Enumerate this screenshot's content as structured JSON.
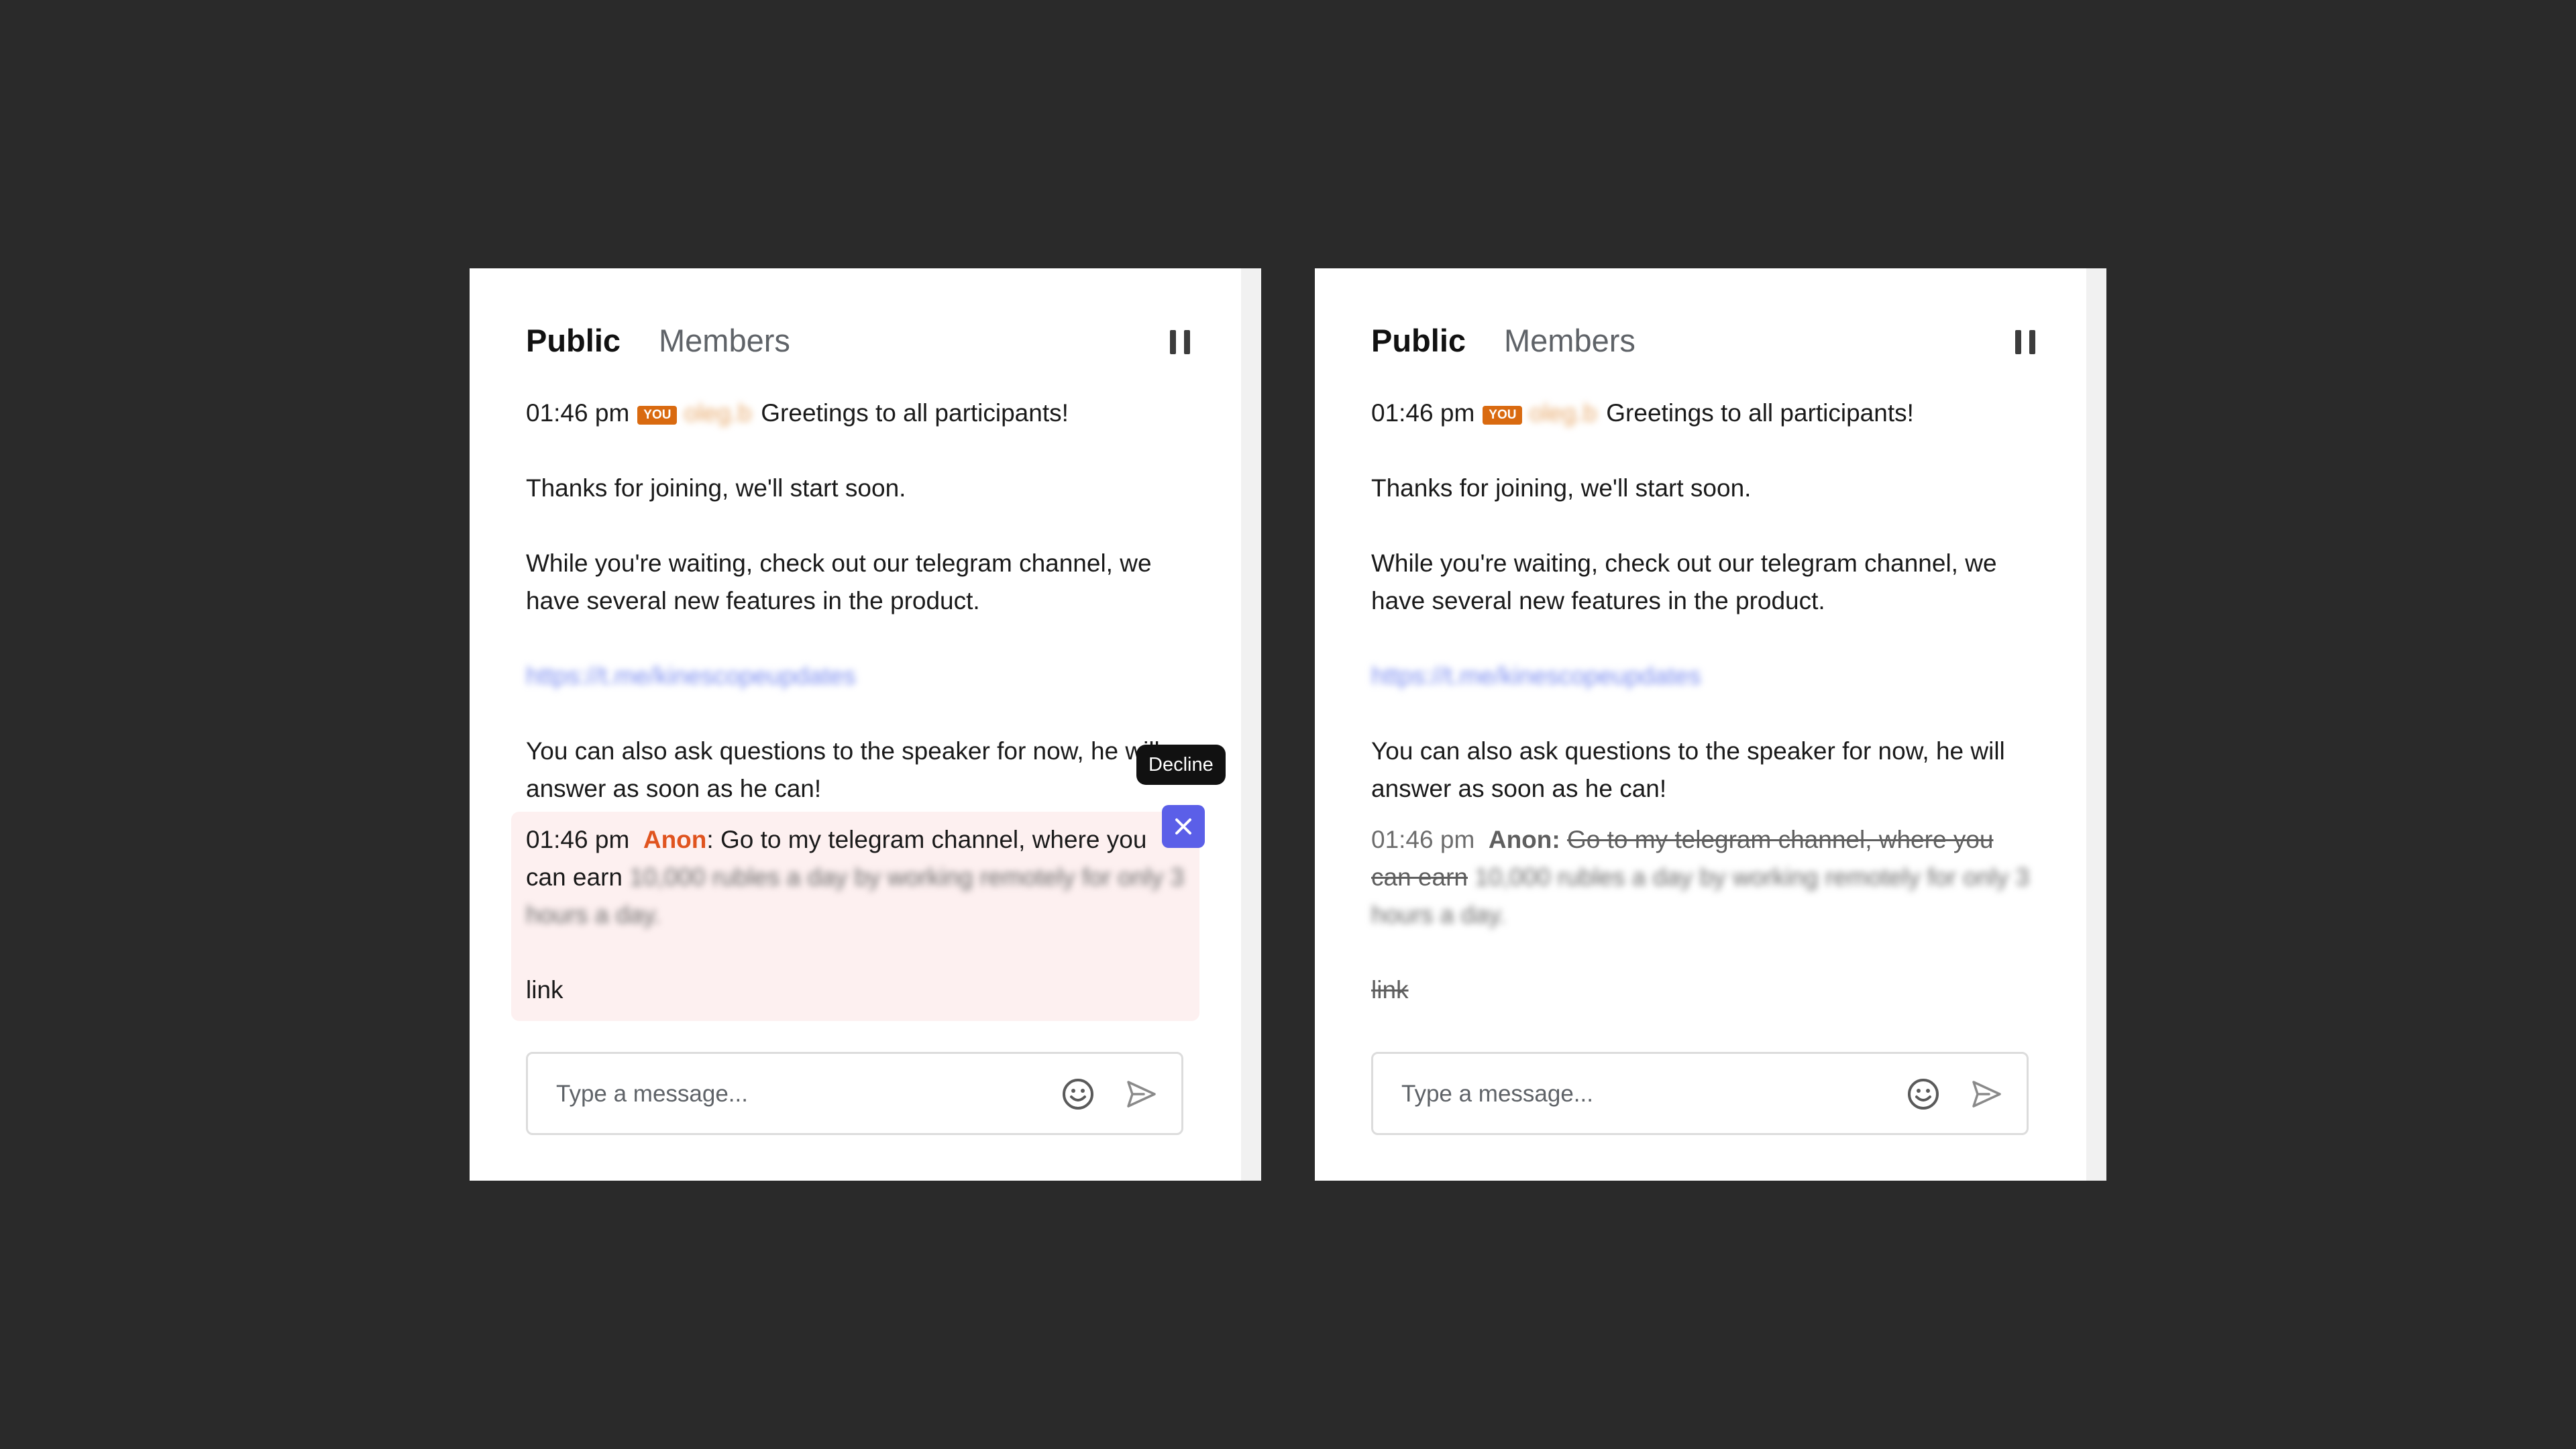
{
  "tabs": {
    "public": "Public",
    "members": "Members"
  },
  "messages": {
    "greeting_time": "01:46 pm",
    "you_badge": "YOU",
    "author_blurred": "oleg.b",
    "greeting": "Greetings to all participants!",
    "thanks": "Thanks for joining, we'll start soon.",
    "waiting_line1": "While you're waiting, check out our telegram channel, we",
    "waiting_line2": "have several new features in the product.",
    "link_blurred": "https://t.me/kinescopeupdates",
    "ask_line1": "You can also ask questions to the speaker for now, he will",
    "ask_line2": "answer as soon as he can!"
  },
  "flagged_message": {
    "time": "01:46 pm",
    "author": "Anon",
    "colon": ":",
    "text_line1": "Go to my telegram channel, where you",
    "text_line2_start": "can earn",
    "blurred_line2": "10,000 rubles a day by working remotely for only 3",
    "blurred_line3": "hours a day.",
    "link_word": "link"
  },
  "decline": {
    "tooltip": "Decline"
  },
  "composer": {
    "placeholder": "Type a message..."
  },
  "colors": {
    "background": "#2a2a2a",
    "panel": "#ffffff",
    "you_badge": "#d96a10",
    "anon_name": "#e0541f",
    "flag_highlight": "#fdf0f0",
    "decline_button": "#5b5fe8"
  },
  "icons": {
    "pause": "pause-icon",
    "close": "close-icon",
    "emoji": "smiley-icon",
    "send": "send-icon"
  }
}
